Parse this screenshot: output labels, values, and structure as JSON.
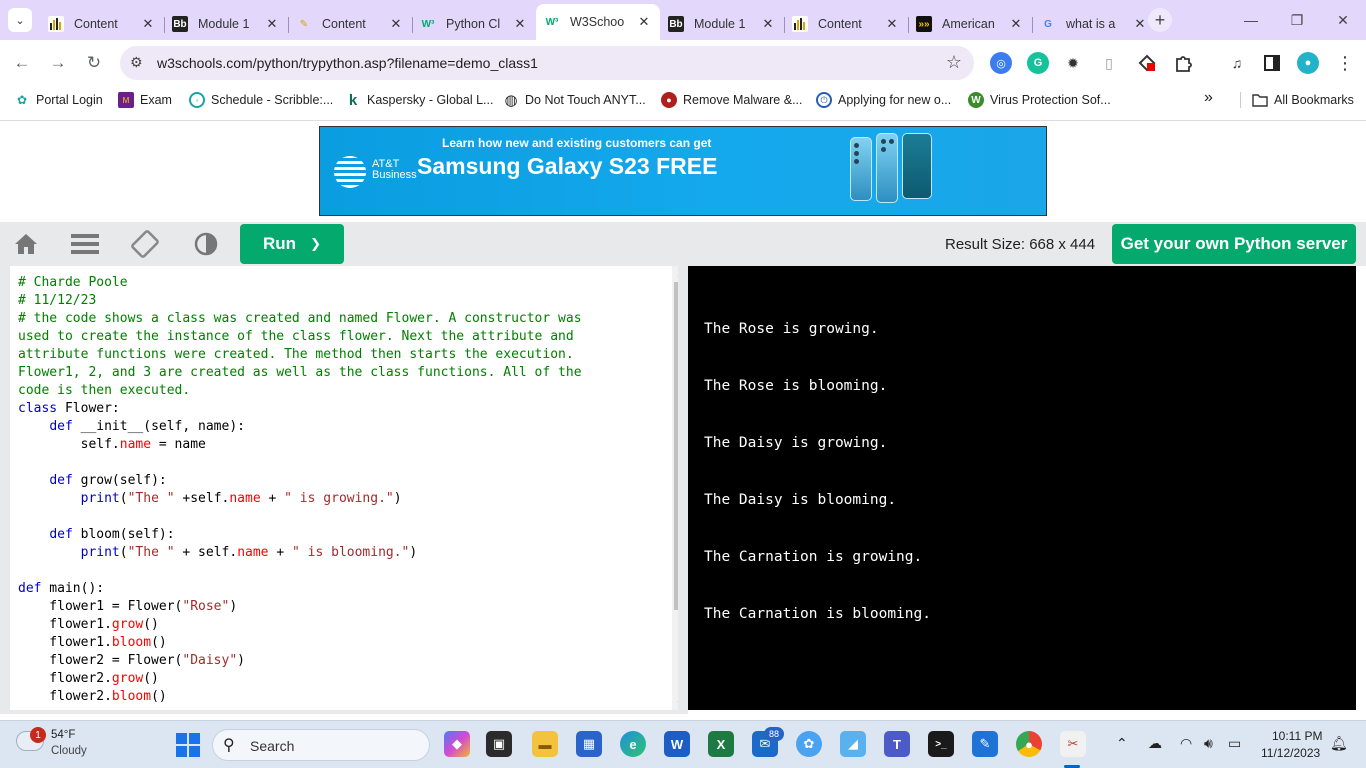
{
  "browser": {
    "tabs": [
      {
        "label": "Content",
        "favicon": "chart-icon"
      },
      {
        "label": "Module 1",
        "favicon": "blackboard-icon"
      },
      {
        "label": "Content",
        "favicon": "document-icon"
      },
      {
        "label": "Python Cl",
        "favicon": "w3schools-icon"
      },
      {
        "label": "W3Schoo",
        "favicon": "w3schools-icon",
        "active": true
      },
      {
        "label": "Module 1",
        "favicon": "blackboard-icon"
      },
      {
        "label": "Content",
        "favicon": "chart-icon"
      },
      {
        "label": "American",
        "favicon": "american-icon"
      },
      {
        "label": "what is a",
        "favicon": "google-icon"
      }
    ],
    "url": "w3schools.com/python/trypython.asp?filename=demo_class1",
    "bookmarks": [
      {
        "label": "Portal Login"
      },
      {
        "label": "Exam"
      },
      {
        "label": "Schedule - Scribble:..."
      },
      {
        "label": "Kaspersky - Global L..."
      },
      {
        "label": "Do Not Touch ANYT..."
      },
      {
        "label": "Remove Malware &..."
      },
      {
        "label": "Applying for new o..."
      },
      {
        "label": "Virus Protection Sof..."
      }
    ],
    "all_bookmarks": "All Bookmarks",
    "overflow": "»"
  },
  "ad": {
    "small": "Learn how new and existing customers can get",
    "big": "Samsung Galaxy S23 FREE",
    "brand_line1": "AT&T",
    "brand_line2": "Business"
  },
  "w3": {
    "run_label": "Run",
    "run_chevron": "❯",
    "result_size": "Result Size: 668 x 444",
    "server_label": "Get your own Python server"
  },
  "output": {
    "lines": [
      "The Rose is growing.",
      "The Rose is blooming.",
      "The Daisy is growing.",
      "The Daisy is blooming.",
      "The Carnation is growing.",
      "The Carnation is blooming."
    ]
  },
  "taskbar": {
    "weather_temp": "54°F",
    "weather_desc": "Cloudy",
    "weather_badge": "1",
    "search_placeholder": "Search",
    "mail_badge": "88",
    "time": "10:11 PM",
    "date": "11/12/2023"
  },
  "colors": {
    "accent": "#04aa6d",
    "tabstrip": "#e3d7fb",
    "taskbar": "#dce6f3"
  }
}
